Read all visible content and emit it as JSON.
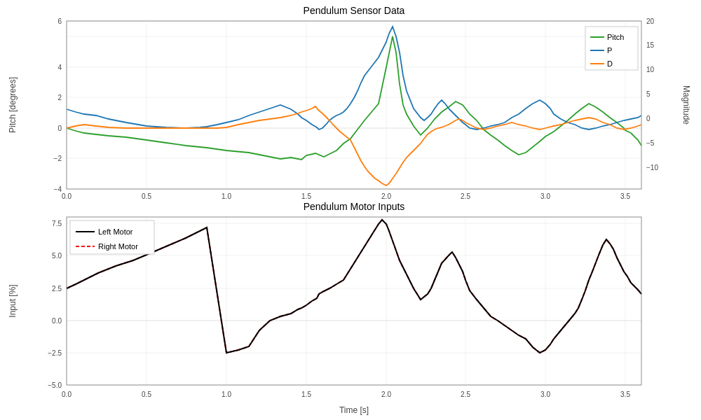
{
  "top_chart": {
    "title": "Pendulum Sensor Data",
    "y_left_label": "Pitch [degrees]",
    "y_right_label": "Magnitude",
    "x_label": "",
    "legend": [
      {
        "label": "Pitch",
        "color": "#2ca02c"
      },
      {
        "label": "P",
        "color": "#1f77b4"
      },
      {
        "label": "D",
        "color": "#ff7f0e"
      }
    ],
    "y_left_ticks": [
      "-4",
      "-2",
      "0",
      "2",
      "4",
      "6"
    ],
    "y_right_ticks": [
      "-10",
      "-5",
      "0",
      "5",
      "10",
      "15",
      "20"
    ],
    "x_ticks": [
      "0.0",
      "0.5",
      "1.0",
      "1.5",
      "2.0",
      "2.5",
      "3.0",
      "3.5"
    ]
  },
  "bottom_chart": {
    "title": "Pendulum Motor Inputs",
    "y_label": "Input [%]",
    "x_label": "Time [s]",
    "legend": [
      {
        "label": "Left Motor",
        "color": "#000000",
        "style": "solid"
      },
      {
        "label": "Right Motor",
        "color": "#ff0000",
        "style": "dashed"
      }
    ],
    "y_ticks": [
      "-5.0",
      "-2.5",
      "0.0",
      "2.5",
      "5.0",
      "7.5"
    ],
    "x_ticks": [
      "0.0",
      "0.5",
      "1.0",
      "1.5",
      "2.0",
      "2.5",
      "3.0",
      "3.5"
    ]
  }
}
